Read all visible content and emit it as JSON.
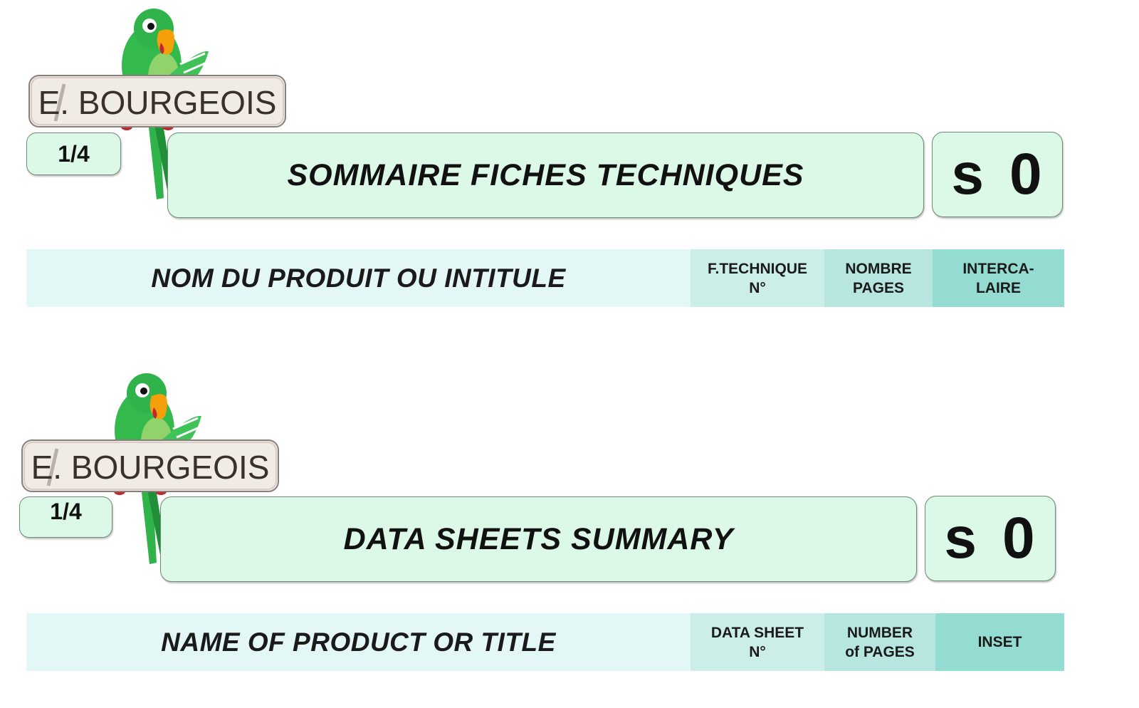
{
  "brand": {
    "logo_text": "E. BOURGEOIS",
    "logo_icon": "parrot-logo-icon",
    "colors": {
      "panel": "#dcf8e6",
      "border": "#6c8a76",
      "parrot": "#2fb34a"
    }
  },
  "sections": [
    {
      "lang": "fr",
      "page": "1/4",
      "title": "SOMMAIRE  FICHES  TECHNIQUES",
      "code_letter": "s",
      "code_number": "0",
      "columns": {
        "name": "NOM DU PRODUIT OU INTITULE",
        "sheet_line1": "F.TECHNIQUE",
        "sheet_line2": "N°",
        "pages_line1": "NOMBRE",
        "pages_line2": "PAGES",
        "inset_line1": "INTERCA-",
        "inset_line2": "LAIRE"
      }
    },
    {
      "lang": "en",
      "page": "1/4",
      "title": "DATA  SHEETS  SUMMARY",
      "code_letter": "s",
      "code_number": "0",
      "columns": {
        "name": "NAME OF PRODUCT OR TITLE",
        "sheet_line1": "DATA SHEET",
        "sheet_line2": "N°",
        "pages_line1": "NUMBER",
        "pages_line2": "of PAGES",
        "inset": "INSET"
      }
    }
  ]
}
